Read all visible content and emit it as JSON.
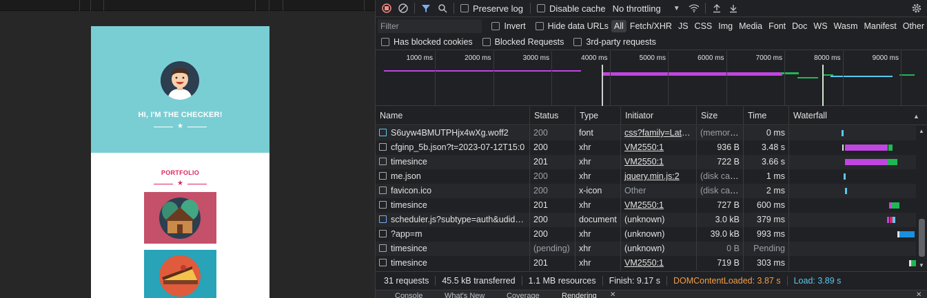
{
  "toolbar": {
    "preserve_log": "Preserve log",
    "disable_cache": "Disable cache",
    "throttling": "No throttling",
    "record_icon": "record-stop-icon",
    "clear_icon": "clear-icon",
    "filter_icon": "filter-icon",
    "search_icon": "search-icon"
  },
  "filterbar": {
    "placeholder": "Filter",
    "invert": "Invert",
    "hide_data_urls": "Hide data URLs",
    "types": [
      "All",
      "Fetch/XHR",
      "JS",
      "CSS",
      "Img",
      "Media",
      "Font",
      "Doc",
      "WS",
      "Wasm",
      "Manifest",
      "Other"
    ],
    "has_blocked_cookies": "Has blocked cookies",
    "blocked_requests": "Blocked Requests",
    "third_party": "3rd-party requests"
  },
  "overview": {
    "ticks": [
      "1000 ms",
      "2000 ms",
      "3000 ms",
      "4000 ms",
      "5000 ms",
      "6000 ms",
      "7000 ms",
      "8000 ms",
      "9000 ms"
    ]
  },
  "columns": {
    "name": "Name",
    "status": "Status",
    "type": "Type",
    "initiator": "Initiator",
    "size": "Size",
    "time": "Time",
    "waterfall": "Waterfall"
  },
  "rows": [
    {
      "name": "S6uyw4BMUTPHjx4wXg.woff2",
      "status": "200",
      "type": "font",
      "initiator": "css?family=Lato:...",
      "size": "(memory...",
      "time": "0 ms"
    },
    {
      "name": "cfginp_5b.json?t=2023-07-12T15:0",
      "status": "200",
      "type": "xhr",
      "initiator": "VM2550:1",
      "size": "936 B",
      "time": "3.48 s"
    },
    {
      "name": "timesince",
      "status": "201",
      "type": "xhr",
      "initiator": "VM2550:1",
      "size": "722 B",
      "time": "3.66 s"
    },
    {
      "name": "me.json",
      "status": "200",
      "type": "xhr",
      "initiator": "jquery.min.js:2",
      "size": "(disk cac...",
      "time": "1 ms"
    },
    {
      "name": "favicon.ico",
      "status": "200",
      "type": "x-icon",
      "initiator": "Other",
      "size": "(disk cac...",
      "time": "2 ms"
    },
    {
      "name": "timesince",
      "status": "201",
      "type": "xhr",
      "initiator": "VM2550:1",
      "size": "727 B",
      "time": "600 ms"
    },
    {
      "name": "scheduler.js?subtype=auth&udid=...",
      "status": "200",
      "type": "document",
      "initiator": "(unknown)",
      "size": "3.0 kB",
      "time": "379 ms"
    },
    {
      "name": "?app=m",
      "status": "200",
      "type": "xhr",
      "initiator": "(unknown)",
      "size": "39.0 kB",
      "time": "993 ms"
    },
    {
      "name": "timesince",
      "status": "(pending)",
      "type": "xhr",
      "initiator": "(unknown)",
      "size": "0 B",
      "time": "Pending"
    },
    {
      "name": "timesince",
      "status": "201",
      "type": "xhr",
      "initiator": "VM2550:1",
      "size": "719 B",
      "time": "303 ms"
    }
  ],
  "summary": {
    "requests": "31 requests",
    "transferred": "45.5 kB transferred",
    "resources": "1.1 MB resources",
    "finish": "Finish: 9.17 s",
    "dcl": "DOMContentLoaded: 3.87 s",
    "load": "Load: 3.89 s"
  },
  "preview": {
    "hero_title": "HI, I'M THE CHECKER!",
    "portfolio": "PORTFOLIO",
    "colors": {
      "hero": "#79ced4",
      "accent": "#e0245e",
      "tile1": "#c4506a",
      "tile2": "#28a3b8"
    }
  },
  "drawer": {
    "tabs": [
      "Console",
      "What's New",
      "Coverage",
      "Rendering"
    ]
  },
  "colors": {
    "dcl": "#f29d49",
    "load": "#5cc8f0",
    "xhr_bar": "#c046e0",
    "recv_bar": "#1db954"
  }
}
